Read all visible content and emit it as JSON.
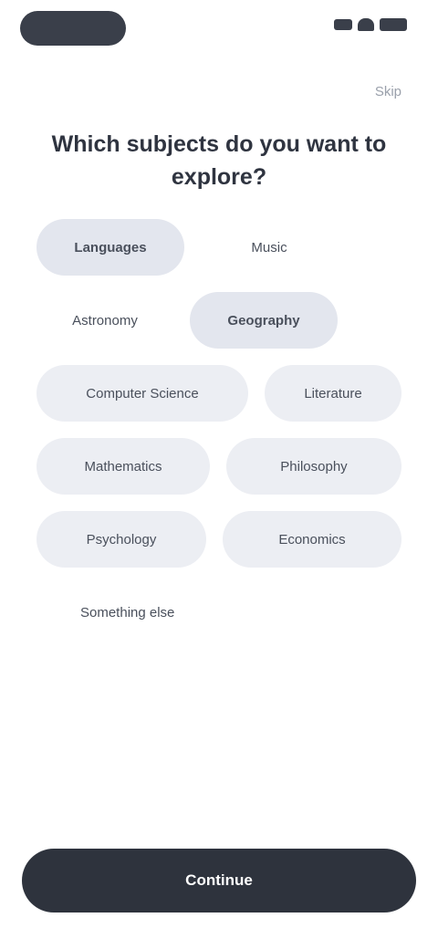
{
  "status_bar": {
    "time": ""
  },
  "header": {
    "skip_label": "Skip"
  },
  "title": "Which subjects do you want to explore?",
  "options": [
    {
      "label": "Languages",
      "selected": true
    },
    {
      "label": "Music",
      "selected": false
    },
    {
      "label": "Astronomy",
      "selected": false
    },
    {
      "label": "Geography",
      "selected": true
    },
    {
      "label": "Computer Science",
      "selected": false
    },
    {
      "label": "Literature",
      "selected": false
    },
    {
      "label": "Mathematics",
      "selected": false
    },
    {
      "label": "Philosophy",
      "selected": false
    },
    {
      "label": "Psychology",
      "selected": false
    },
    {
      "label": "Economics",
      "selected": false
    },
    {
      "label": "Something else",
      "selected": false
    }
  ],
  "footer": {
    "continue_label": "Continue"
  }
}
